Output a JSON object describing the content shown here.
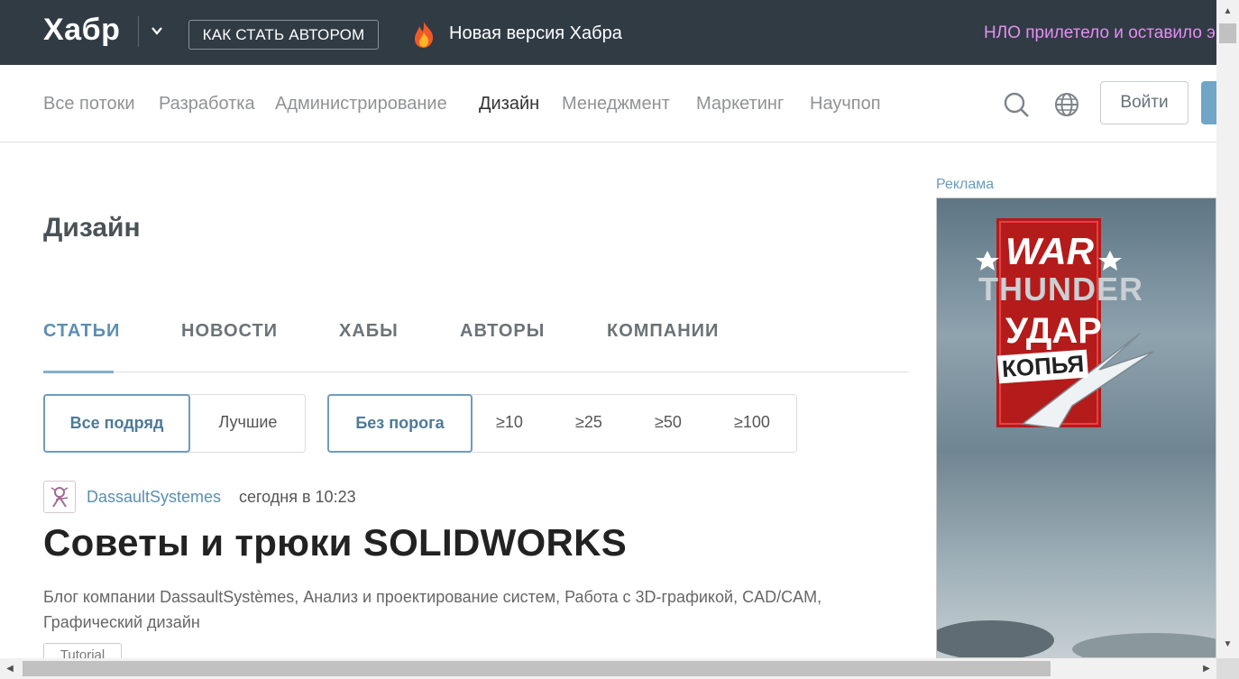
{
  "topbar": {
    "logo": "Хабр",
    "author_button": "КАК СТАТЬ АВТОРОМ",
    "promo_text": "Новая версия Хабра",
    "ufo_text": "НЛО прилетело и оставило э"
  },
  "nav": {
    "items": [
      "Все потоки",
      "Разработка",
      "Администрирование",
      "Дизайн",
      "Менеджмент",
      "Маркетинг",
      "Научпоп"
    ],
    "active": "Дизайн",
    "login": "Войти"
  },
  "page": {
    "title": "Дизайн",
    "tabs": [
      "СТАТЬИ",
      "НОВОСТИ",
      "ХАБЫ",
      "АВТОРЫ",
      "КОМПАНИИ"
    ],
    "active_tab": "СТАТЬИ"
  },
  "filters": {
    "sort": [
      "Все подряд",
      "Лучшие"
    ],
    "sort_active": "Все подряд",
    "threshold": [
      "Без порога",
      "≥10",
      "≥25",
      "≥50",
      "≥100"
    ],
    "threshold_active": "Без порога"
  },
  "post": {
    "author": "DassaultSystemes",
    "time": "сегодня в 10:23",
    "title": "Советы и трюки SOLIDWORKS",
    "hubs": "Блог компании DassaultSystèmes,  Анализ и проектирование систем,  Работа с 3D-графикой,  CAD/CAM,  Графический дизайн",
    "badge": "Tutorial"
  },
  "ad": {
    "label": "Реклама",
    "line1": "WAR",
    "line2": "THUNDER",
    "line3": "УДАР",
    "line4": "КОПЬЯ"
  },
  "colors": {
    "topbar": "#303b44",
    "link": "#5b8eb0",
    "ufo": "#e58ef2"
  }
}
